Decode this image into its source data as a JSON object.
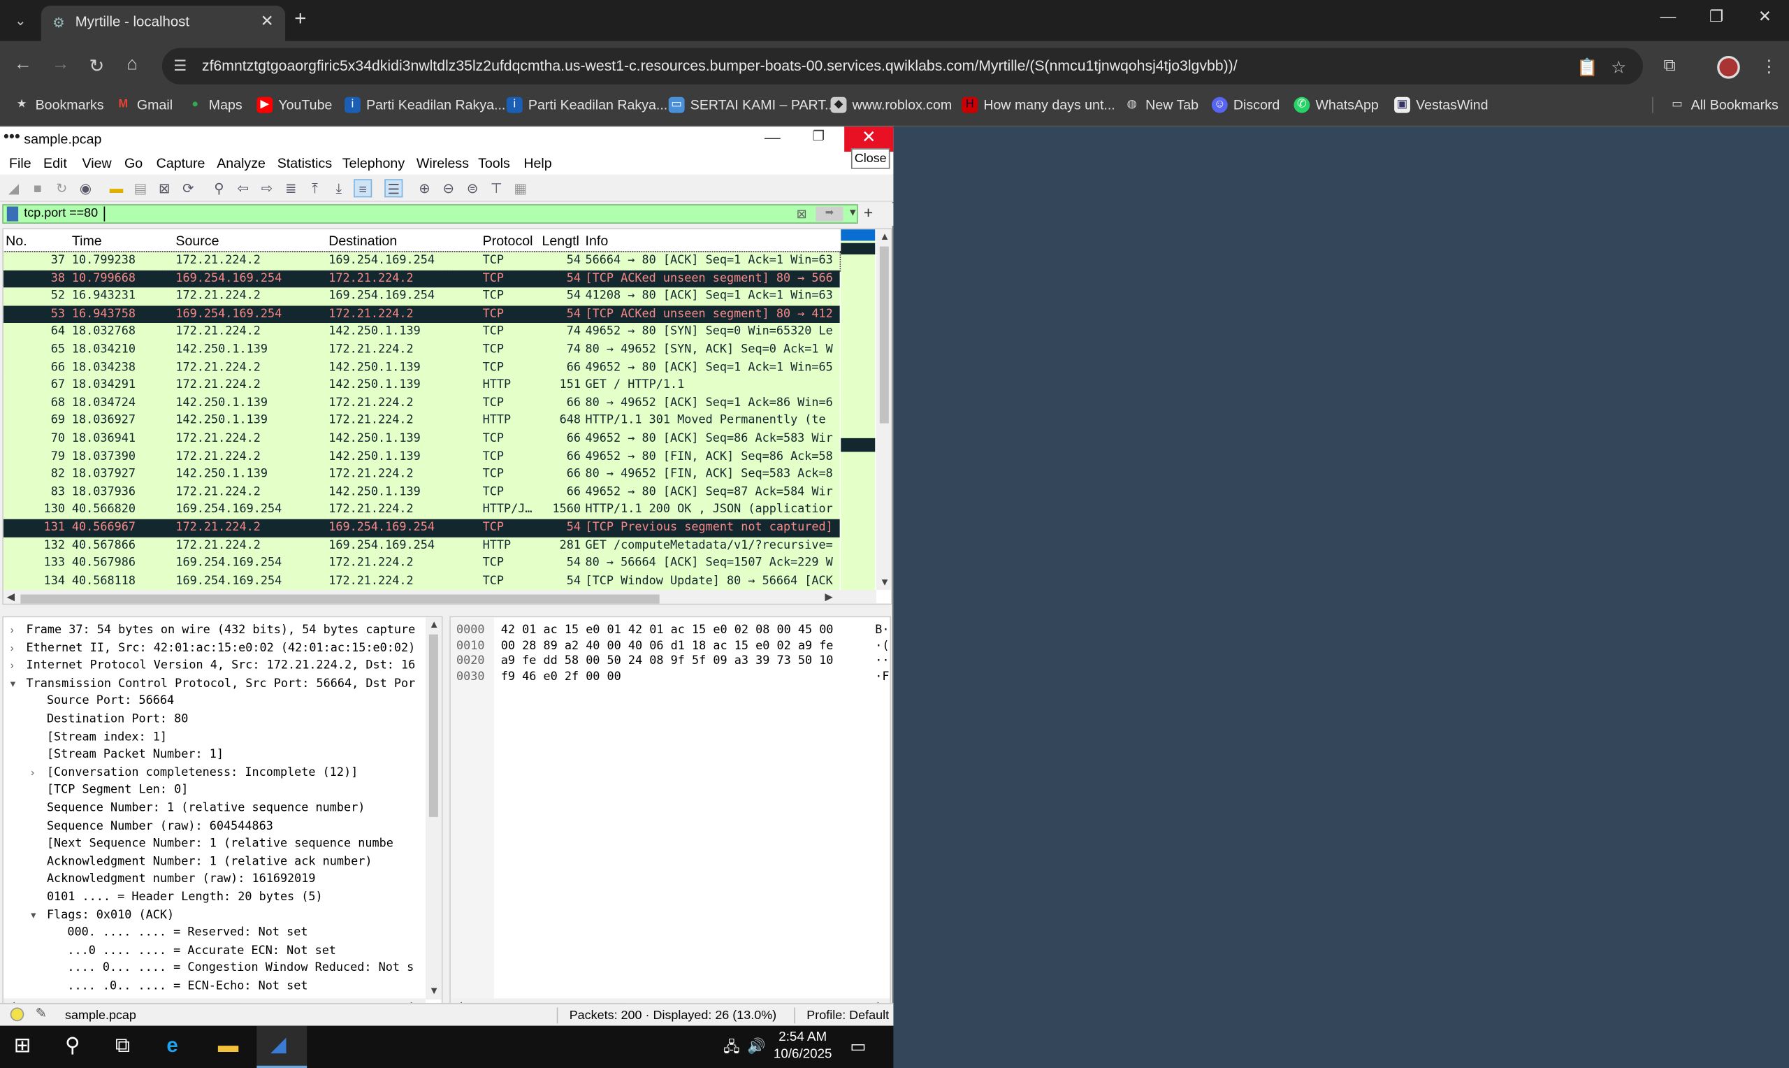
{
  "browser": {
    "tab_title": "Myrtille - localhost",
    "url": "zf6mntztgtgoaorgfiric5x34dkidi3nwltdlz35lz2ufdqcmtha.us-west1-c.resources.bumper-boats-00.services.qwiklabs.com/Myrtille/(S(nmcu1tjnwqohsj4tjo3lgvbb))/",
    "bookmarks": [
      "Bookmarks",
      "Gmail",
      "Maps",
      "YouTube",
      "Parti Keadilan Rakya...",
      "Parti Keadilan Rakya...",
      "SERTAI KAMI – PART...",
      "www.roblox.com",
      "How many days unt...",
      "New Tab",
      "Discord",
      "WhatsApp",
      "VestasWind"
    ],
    "all_bookmarks": "All Bookmarks"
  },
  "wireshark": {
    "title": "sample.pcap",
    "close_tooltip": "Close",
    "menu": [
      "File",
      "Edit",
      "View",
      "Go",
      "Capture",
      "Analyze",
      "Statistics",
      "Telephony",
      "Wireless",
      "Tools",
      "Help"
    ],
    "filter": "tcp.port ==80",
    "columns": [
      "No.",
      "Time",
      "Source",
      "Destination",
      "Protocol",
      "Lengtl",
      "Info"
    ],
    "packets": [
      {
        "no": "37",
        "time": "10.799238",
        "src": "172.21.224.2",
        "dst": "169.254.169.254",
        "proto": "TCP",
        "len": "54",
        "info": "56664 → 80 [ACK] Seq=1 Ack=1 Win=63",
        "style": "green"
      },
      {
        "no": "38",
        "time": "10.799668",
        "src": "169.254.169.254",
        "dst": "172.21.224.2",
        "proto": "TCP",
        "len": "54",
        "info": "[TCP ACKed unseen segment] 80 → 566",
        "style": "dark"
      },
      {
        "no": "52",
        "time": "16.943231",
        "src": "172.21.224.2",
        "dst": "169.254.169.254",
        "proto": "TCP",
        "len": "54",
        "info": "41208 → 80 [ACK] Seq=1 Ack=1 Win=63",
        "style": "green"
      },
      {
        "no": "53",
        "time": "16.943758",
        "src": "169.254.169.254",
        "dst": "172.21.224.2",
        "proto": "TCP",
        "len": "54",
        "info": "[TCP ACKed unseen segment] 80 → 412",
        "style": "dark"
      },
      {
        "no": "64",
        "time": "18.032768",
        "src": "172.21.224.2",
        "dst": "142.250.1.139",
        "proto": "TCP",
        "len": "74",
        "info": "49652 → 80 [SYN] Seq=0 Win=65320 Le",
        "style": "green"
      },
      {
        "no": "65",
        "time": "18.034210",
        "src": "142.250.1.139",
        "dst": "172.21.224.2",
        "proto": "TCP",
        "len": "74",
        "info": "80 → 49652 [SYN, ACK] Seq=0 Ack=1 W",
        "style": "green"
      },
      {
        "no": "66",
        "time": "18.034238",
        "src": "172.21.224.2",
        "dst": "142.250.1.139",
        "proto": "TCP",
        "len": "66",
        "info": "49652 → 80 [ACK] Seq=1 Ack=1 Win=65",
        "style": "green"
      },
      {
        "no": "67",
        "time": "18.034291",
        "src": "172.21.224.2",
        "dst": "142.250.1.139",
        "proto": "HTTP",
        "len": "151",
        "info": "GET / HTTP/1.1",
        "style": "green"
      },
      {
        "no": "68",
        "time": "18.034724",
        "src": "142.250.1.139",
        "dst": "172.21.224.2",
        "proto": "TCP",
        "len": "66",
        "info": "80 → 49652 [ACK] Seq=1 Ack=86 Win=6",
        "style": "green"
      },
      {
        "no": "69",
        "time": "18.036927",
        "src": "142.250.1.139",
        "dst": "172.21.224.2",
        "proto": "HTTP",
        "len": "648",
        "info": "HTTP/1.1 301 Moved Permanently  (te",
        "style": "green"
      },
      {
        "no": "70",
        "time": "18.036941",
        "src": "172.21.224.2",
        "dst": "142.250.1.139",
        "proto": "TCP",
        "len": "66",
        "info": "49652 → 80 [ACK] Seq=86 Ack=583 Wir",
        "style": "green"
      },
      {
        "no": "79",
        "time": "18.037390",
        "src": "172.21.224.2",
        "dst": "142.250.1.139",
        "proto": "TCP",
        "len": "66",
        "info": "49652 → 80 [FIN, ACK] Seq=86 Ack=58",
        "style": "green"
      },
      {
        "no": "82",
        "time": "18.037927",
        "src": "142.250.1.139",
        "dst": "172.21.224.2",
        "proto": "TCP",
        "len": "66",
        "info": "80 → 49652 [FIN, ACK] Seq=583 Ack=8",
        "style": "green"
      },
      {
        "no": "83",
        "time": "18.037936",
        "src": "172.21.224.2",
        "dst": "142.250.1.139",
        "proto": "TCP",
        "len": "66",
        "info": "49652 → 80 [ACK] Seq=87 Ack=584 Wir",
        "style": "green"
      },
      {
        "no": "130",
        "time": "40.566820",
        "src": "169.254.169.254",
        "dst": "172.21.224.2",
        "proto": "HTTP/J…",
        "len": "1560",
        "info": "HTTP/1.1 200 OK , JSON (applicatior",
        "style": "green"
      },
      {
        "no": "131",
        "time": "40.566967",
        "src": "172.21.224.2",
        "dst": "169.254.169.254",
        "proto": "TCP",
        "len": "54",
        "info": "[TCP Previous segment not captured]",
        "style": "dark"
      },
      {
        "no": "132",
        "time": "40.567866",
        "src": "172.21.224.2",
        "dst": "169.254.169.254",
        "proto": "HTTP",
        "len": "281",
        "info": "GET /computeMetadata/v1/?recursive=",
        "style": "green"
      },
      {
        "no": "133",
        "time": "40.567986",
        "src": "169.254.169.254",
        "dst": "172.21.224.2",
        "proto": "TCP",
        "len": "54",
        "info": "80 → 56664 [ACK] Seq=1507 Ack=229 W",
        "style": "green"
      },
      {
        "no": "134",
        "time": "40.568118",
        "src": "169.254.169.254",
        "dst": "172.21.224.2",
        "proto": "TCP",
        "len": "54",
        "info": "[TCP Window Update] 80 → 56664 [ACK",
        "style": "green"
      }
    ],
    "details": [
      {
        "text": "Frame 37: 54 bytes on wire (432 bits), 54 bytes capture",
        "caret": "›",
        "indent": 0
      },
      {
        "text": "Ethernet II, Src: 42:01:ac:15:e0:02 (42:01:ac:15:e0:02)",
        "caret": "›",
        "indent": 0
      },
      {
        "text": "Internet Protocol Version 4, Src: 172.21.224.2, Dst: 16",
        "caret": "›",
        "indent": 0
      },
      {
        "text": "Transmission Control Protocol, Src Port: 56664, Dst Por",
        "caret": "⌄",
        "indent": 0
      },
      {
        "text": "Source Port: 56664",
        "caret": "",
        "indent": 1
      },
      {
        "text": "Destination Port: 80",
        "caret": "",
        "indent": 1
      },
      {
        "text": "[Stream index: 1]",
        "caret": "",
        "indent": 1
      },
      {
        "text": "[Stream Packet Number: 1]",
        "caret": "",
        "indent": 1
      },
      {
        "text": "[Conversation completeness: Incomplete (12)]",
        "caret": "›",
        "indent": 1
      },
      {
        "text": "[TCP Segment Len: 0]",
        "caret": "",
        "indent": 1
      },
      {
        "text": "Sequence Number: 1    (relative sequence number)",
        "caret": "",
        "indent": 1
      },
      {
        "text": "Sequence Number (raw): 604544863",
        "caret": "",
        "indent": 1
      },
      {
        "text": "[Next Sequence Number: 1    (relative sequence numbe",
        "caret": "",
        "indent": 1
      },
      {
        "text": "Acknowledgment Number: 1    (relative ack number)",
        "caret": "",
        "indent": 1
      },
      {
        "text": "Acknowledgment number (raw): 161692019",
        "caret": "",
        "indent": 1
      },
      {
        "text": "0101 .... = Header Length: 20 bytes (5)",
        "caret": "",
        "indent": 1
      },
      {
        "text": "Flags: 0x010 (ACK)",
        "caret": "⌄",
        "indent": 1
      },
      {
        "text": "000. .... .... = Reserved: Not set",
        "caret": "",
        "indent": 2
      },
      {
        "text": "...0 .... .... = Accurate ECN: Not set",
        "caret": "",
        "indent": 2
      },
      {
        "text": ".... 0... .... = Congestion Window Reduced: Not s",
        "caret": "",
        "indent": 2
      },
      {
        "text": ".... .0.. .... = ECN-Echo: Not set",
        "caret": "",
        "indent": 2
      }
    ],
    "bytes": [
      {
        "off": "0000",
        "hex": "42 01 ac 15 e0 01 42 01  ac 15 e0 02 08 00 45 00",
        "ascii": "B·"
      },
      {
        "off": "0010",
        "hex": "00 28 89 a2 40 00 40 06  d1 18 ac 15 e0 02 a9 fe",
        "ascii": "·("
      },
      {
        "off": "0020",
        "hex": "a9 fe dd 58 00 50 24 08  9f 5f 09 a3 39 73 50 10",
        "ascii": "··"
      },
      {
        "off": "0030",
        "hex": "f9 46 e0 2f 00 00",
        "ascii": "·F"
      }
    ],
    "status": {
      "file": "sample.pcap",
      "packets": "Packets: 200 · Displayed: 26 (13.0%)",
      "profile": "Profile: Default"
    }
  },
  "taskbar": {
    "time": "2:54 AM",
    "date": "10/6/2025"
  }
}
